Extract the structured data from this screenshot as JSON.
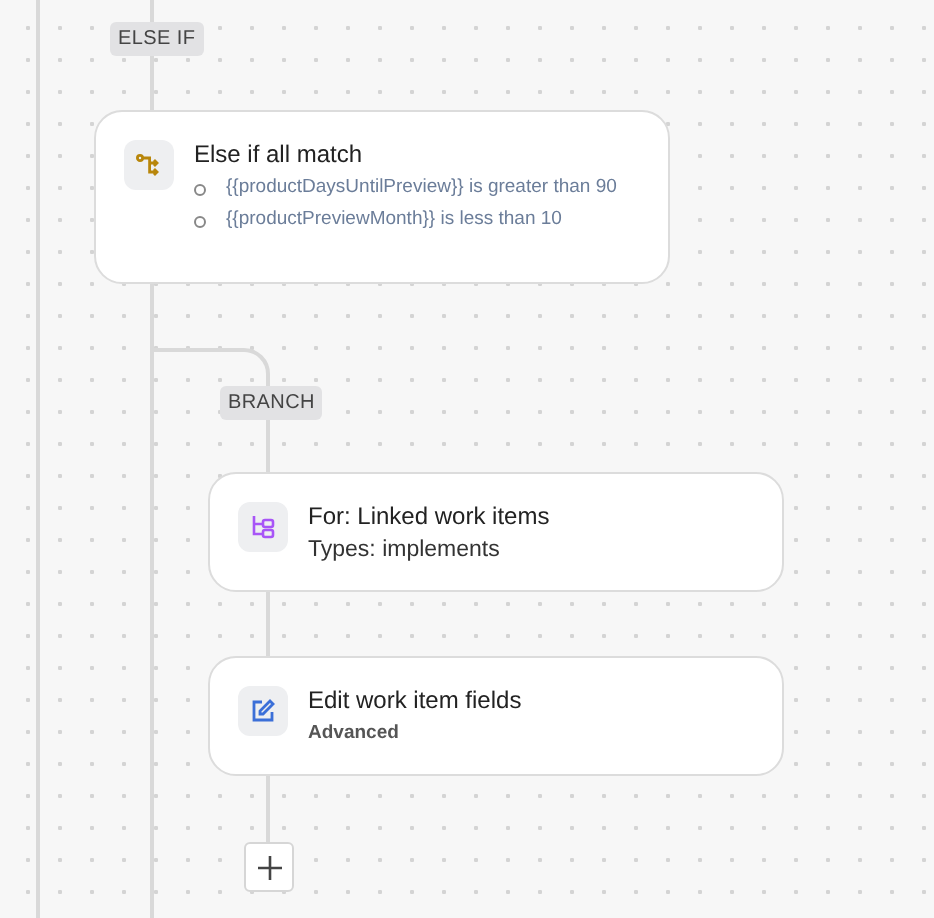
{
  "else_if_label": "ELSE IF",
  "condition_card": {
    "kind": "condition",
    "title": "Else if all match",
    "conditions": [
      "{{productDaysUntilPreview}} is greater than 90",
      "{{productPreviewMonth}} is less than 10"
    ]
  },
  "branch_label": "BRANCH",
  "steps": [
    {
      "kind": "branch",
      "title": "For: Linked work items",
      "subtitle": "Types: implements"
    },
    {
      "kind": "edit",
      "title": "Edit work item fields",
      "subtitle": "Advanced"
    }
  ]
}
